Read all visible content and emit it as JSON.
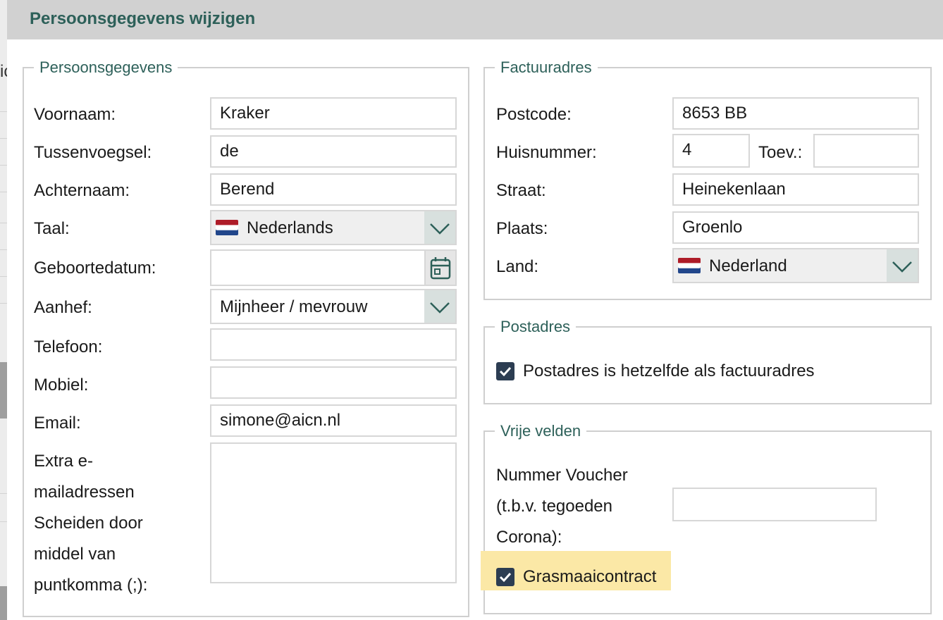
{
  "dialog": {
    "title": "Persoonsgegevens wijzigen"
  },
  "background": {
    "fragment": "ic"
  },
  "personal": {
    "legend": "Persoonsgegevens",
    "voornaam": {
      "label": "Voornaam:",
      "value": "Kraker"
    },
    "tussenvoegsel": {
      "label": "Tussenvoegsel:",
      "value": "de"
    },
    "achternaam": {
      "label": "Achternaam:",
      "value": "Berend"
    },
    "taal": {
      "label": "Taal:",
      "value": "Nederlands",
      "flag_icon": "dutch-flag-icon"
    },
    "geboortedatum": {
      "label": "Geboortedatum:",
      "value": "",
      "icon": "calendar-icon"
    },
    "aanhef": {
      "label": "Aanhef:",
      "value": "Mijnheer / mevrouw"
    },
    "telefoon": {
      "label": "Telefoon:",
      "value": ""
    },
    "mobiel": {
      "label": "Mobiel:",
      "value": ""
    },
    "email": {
      "label": "Email:",
      "value": "simone@aicn.nl"
    },
    "extra_email": {
      "label_lines": [
        "Extra e-",
        "mailadressen",
        "Scheiden door",
        "middel van",
        "puntkomma (;):"
      ],
      "value": ""
    }
  },
  "billing": {
    "legend": "Factuuradres",
    "postcode": {
      "label": "Postcode:",
      "value": "8653 BB"
    },
    "huisnummer": {
      "label": "Huisnummer:",
      "value": "4"
    },
    "toevoeging": {
      "label": "Toev.:",
      "value": ""
    },
    "straat": {
      "label": "Straat:",
      "value": "Heinekenlaan"
    },
    "plaats": {
      "label": "Plaats:",
      "value": "Groenlo"
    },
    "land": {
      "label": "Land:",
      "value": "Nederland",
      "flag_icon": "dutch-flag-icon"
    }
  },
  "postal": {
    "legend": "Postadres",
    "same_as_billing": {
      "label": "Postadres is hetzelfde als factuuradres",
      "checked": true
    }
  },
  "free_fields": {
    "legend": "Vrije velden",
    "voucher": {
      "label_lines": [
        "Nummer Voucher",
        "(t.b.v. tegoeden",
        "Corona):"
      ],
      "value": ""
    },
    "grasmaai": {
      "label": "Grasmaaicontract",
      "checked": true
    }
  },
  "colors": {
    "accent": "#2d6059",
    "checkbox": "#2c3d52",
    "highlight": "#fbe8a6",
    "titlebar": "#d1d1d1"
  }
}
